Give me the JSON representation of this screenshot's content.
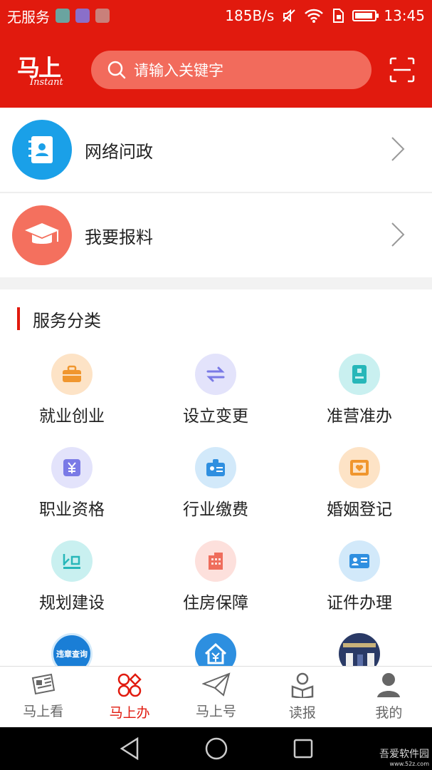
{
  "status_bar": {
    "carrier": "无服务",
    "net_speed": "185B/s",
    "time": "13:45",
    "battery_level": 0.85
  },
  "header": {
    "logo_text": "马上",
    "logo_subtext": "Instant",
    "search_placeholder": "请输入关键字"
  },
  "shortcuts": [
    {
      "label": "网络问政",
      "icon": "contact-book-icon",
      "color": "#1aa0e8"
    },
    {
      "label": "我要报料",
      "icon": "graduation-cap-icon",
      "color": "#f4705e"
    }
  ],
  "services": {
    "title": "服务分类",
    "items": [
      {
        "label": "就业创业",
        "icon": "briefcase-icon",
        "bg": "#fde3c6",
        "fg": "#f0962e"
      },
      {
        "label": "设立变更",
        "icon": "swap-arrows-icon",
        "bg": "#e3e3fb",
        "fg": "#7a7ae6"
      },
      {
        "label": "准营准办",
        "icon": "document-icon",
        "bg": "#c9f0f0",
        "fg": "#27b7b9"
      },
      {
        "label": "职业资格",
        "icon": "yuan-icon",
        "bg": "#e3e3fb",
        "fg": "#7a7ae6"
      },
      {
        "label": "行业缴费",
        "icon": "id-badge-icon",
        "bg": "#d2e9fa",
        "fg": "#2f8fe0"
      },
      {
        "label": "婚姻登记",
        "icon": "heart-frame-icon",
        "bg": "#fde3c6",
        "fg": "#f0962e"
      },
      {
        "label": "规划建设",
        "icon": "planning-icon",
        "bg": "#c9f0f0",
        "fg": "#27b7b9"
      },
      {
        "label": "住房保障",
        "icon": "building-icon",
        "bg": "#fde0dc",
        "fg": "#ef6d5c"
      },
      {
        "label": "证件办理",
        "icon": "id-card-icon",
        "bg": "#d2e9fa",
        "fg": "#2f8fe0"
      },
      {
        "label": "",
        "icon": "traffic-violation-icon",
        "badge_text": "违章查询",
        "bg": "#1a7ed6",
        "fg": "#ffffff"
      },
      {
        "label": "",
        "icon": "house-yuan-icon",
        "bg": "#2d8fe0",
        "fg": "#ffffff"
      },
      {
        "label": "",
        "icon": "service-hall-photo-icon",
        "bg": "#2a3a66",
        "fg": "#ffffff"
      }
    ]
  },
  "tabs": [
    {
      "label": "马上看",
      "icon": "newspaper-icon",
      "active": false
    },
    {
      "label": "马上办",
      "icon": "grid-apps-icon",
      "active": true
    },
    {
      "label": "马上号",
      "icon": "paper-plane-icon",
      "active": false
    },
    {
      "label": "读报",
      "icon": "reader-icon",
      "active": false
    },
    {
      "label": "我的",
      "icon": "user-icon",
      "active": false
    }
  ],
  "watermark": {
    "text": "吾爱软件园",
    "url": "www.52z.com"
  },
  "colors": {
    "brand_red": "#e11a0e",
    "search_bg": "#f26b5c"
  }
}
